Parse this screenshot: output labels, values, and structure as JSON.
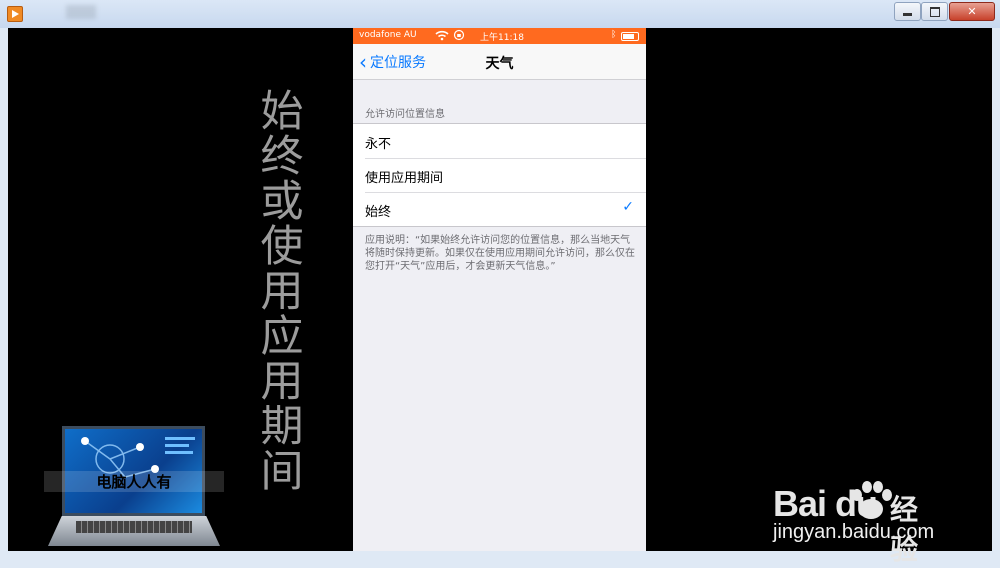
{
  "window": {
    "controls": [
      "minimize",
      "maximize",
      "close"
    ]
  },
  "video": {
    "side_caption": "始终或使用应用期间",
    "logo_caption": "电脑人人有"
  },
  "phone": {
    "status": {
      "carrier": "vodafone AU",
      "time": "上午11:18"
    },
    "nav": {
      "back_label": "定位服务",
      "title": "天气"
    },
    "section_header": "允许访问位置信息",
    "options": [
      {
        "label": "永不",
        "selected": false
      },
      {
        "label": "使用应用期间",
        "selected": false
      },
      {
        "label": "始终",
        "selected": true
      }
    ],
    "footer": "应用说明：“如果始终允许访问您的位置信息，那么当地天气将随时保持更新。如果仅在使用应用期间允许访问，那么仅在您打开“天气”应用后，才会更新天气信息。”"
  },
  "watermark": {
    "brand": "Bai du",
    "brand_cn": "经验",
    "url": "jingyan.baidu.com"
  },
  "colors": {
    "accent": "#0a7aff",
    "status_bar": "#ff6a1f"
  }
}
